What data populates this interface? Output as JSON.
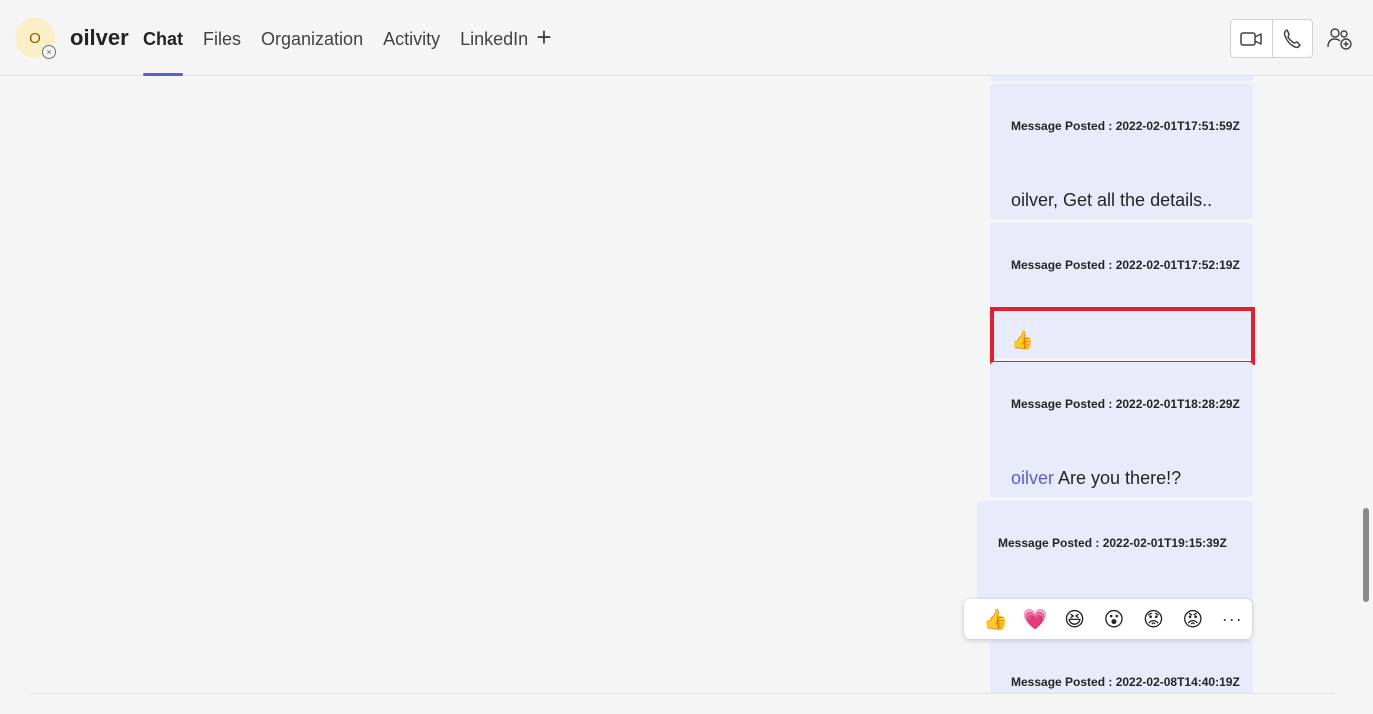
{
  "header": {
    "avatar_initial": "O",
    "presence_symbol": "×",
    "contact_name": "oilver",
    "tabs": [
      {
        "label": "Chat",
        "active": true
      },
      {
        "label": "Files"
      },
      {
        "label": "Organization"
      },
      {
        "label": "Activity"
      },
      {
        "label": "LinkedIn"
      }
    ],
    "add_tab_symbol": "+",
    "icons": {
      "video": "video-call-icon",
      "audio": "audio-call-icon",
      "people": "add-people-icon"
    }
  },
  "messages": [
    {
      "posted": "Message Posted : 2022-02-01T17:51:59Z",
      "text": "oilver, Get all the details.."
    },
    {
      "posted": "Message Posted : 2022-02-01T17:52:19Z",
      "emoji": "👍"
    },
    {
      "posted": "Message Posted : 2022-02-01T18:28:29Z",
      "mention": "oilver",
      "text": " Are you there!?"
    },
    {
      "posted": "Message Posted : 2022-02-01T19:15:39Z"
    },
    {
      "posted": "Message Posted : 2022-02-08T14:40:19Z"
    }
  ],
  "reactions": {
    "items": [
      "👍",
      "💗",
      "😆",
      "😮",
      "😟",
      "😡"
    ],
    "more_label": "···"
  },
  "colors": {
    "accent": "#5b5fc7",
    "bubble": "#e8ebfa",
    "highlight": "#e0202e",
    "background": "#f5f5f5"
  }
}
